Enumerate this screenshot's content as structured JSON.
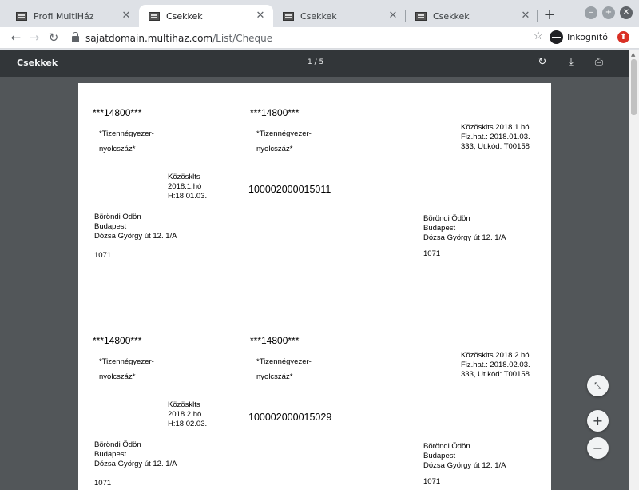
{
  "tabs": [
    {
      "title": "Profi MultiHáz",
      "active": false
    },
    {
      "title": "Csekkek",
      "active": true
    },
    {
      "title": "Csekkek",
      "active": false
    },
    {
      "title": "Csekkek",
      "active": false
    }
  ],
  "address": {
    "host": "sajatdomain.multihaz.com",
    "path": "/List/Cheque"
  },
  "incognito_label": "Inkognitó",
  "pdf": {
    "title": "Csekkek",
    "page_indicator": "1 / 5"
  },
  "cheques": [
    {
      "amount": "***14800***",
      "amount_words_1": "*Tizennégyezer-",
      "amount_words_2": "nyolcszáz*",
      "memo_1": "Közösklts",
      "memo_2": "2018.1.hó",
      "memo_3": "H:18.01.03.",
      "account": "100002000015011",
      "right_1": "Közösklts 2018.1.hó",
      "right_2": "Fiz.hat.: 2018.01.03.",
      "right_3": "333, Ut.kód: T00158",
      "name": "Böröndi Ödön",
      "city": "Budapest",
      "street": "Dózsa György út 12. 1/A",
      "zip": "1071"
    },
    {
      "amount": "***14800***",
      "amount_words_1": "*Tizennégyezer-",
      "amount_words_2": "nyolcszáz*",
      "memo_1": "Közösklts",
      "memo_2": "2018.2.hó",
      "memo_3": "H:18.02.03.",
      "account": "100002000015029",
      "right_1": "Közösklts 2018.2.hó",
      "right_2": "Fiz.hat.: 2018.02.03.",
      "right_3": "333, Ut.kód: T00158",
      "name": "Böröndi Ödön",
      "city": "Budapest",
      "street": "Dózsa György út 12. 1/A",
      "zip": "1071"
    }
  ]
}
